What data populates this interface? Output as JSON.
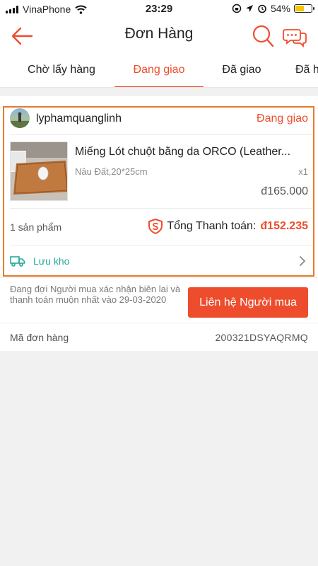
{
  "status_bar": {
    "carrier": "VinaPhone",
    "time": "23:29",
    "battery": "54%",
    "battery_level": 0.54
  },
  "header": {
    "title": "Đơn Hàng",
    "back_icon": "arrow-left-icon",
    "search_icon": "search-icon",
    "chat_icon": "chat-icon",
    "accent_color": "#ee4d2d"
  },
  "tabs": [
    {
      "label": "Chờ lấy hàng",
      "active": false
    },
    {
      "label": "Đang giao",
      "active": true
    },
    {
      "label": "Đã giao",
      "active": false
    },
    {
      "label": "Đã h",
      "active": false
    }
  ],
  "order": {
    "shop_name": "lyphamquanglinh",
    "status": "Đang giao",
    "product": {
      "name": "Miếng Lót chuột bằng da ORCO (Leather...",
      "variation": "Nâu Đất,20*25cm",
      "quantity": "x1",
      "price": "đ165.000"
    },
    "item_count": "1 sản phẩm",
    "total_label": "Tổng Thanh toán:",
    "total_amount": "đ152.235",
    "shipping_status": "Lưu kho",
    "note": "Đang đợi Người mua xác nhận biên lai và thanh toán muộn nhất vào 29-03-2020",
    "contact_button": "Liên hệ Người mua",
    "order_code_label": "Mã đơn hàng",
    "order_code": "200321DSYAQRMQ"
  }
}
